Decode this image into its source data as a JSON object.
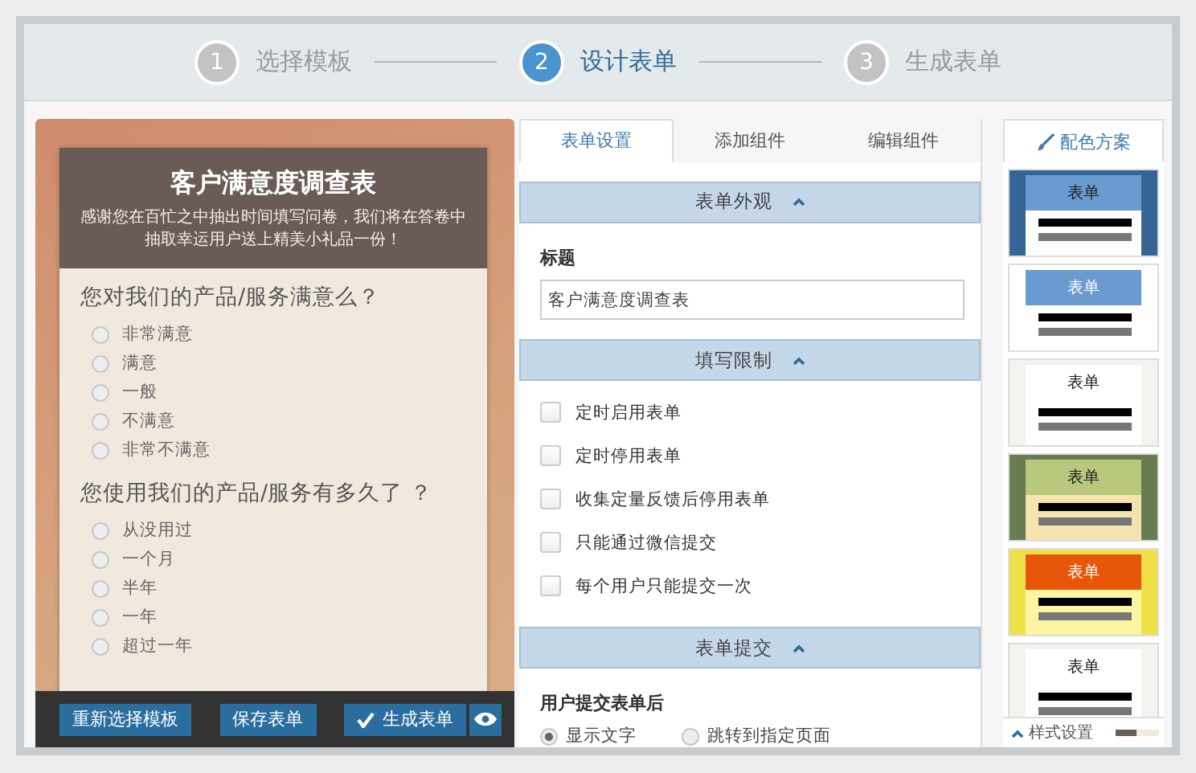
{
  "steps": [
    {
      "number": "1",
      "label": "选择模板",
      "selected": false
    },
    {
      "number": "2",
      "label": "设计表单",
      "selected": true
    },
    {
      "number": "3",
      "label": "生成表单",
      "selected": false
    }
  ],
  "preview": {
    "title": "客户满意度调查表",
    "subtitle": "感谢您在百忙之中抽出时间填写问卷，我们将在答卷中抽取幸运用户送上精美小礼品一份！",
    "questions": [
      {
        "text": "您对我们的产品/服务满意么？",
        "options": [
          {
            "label": "非常满意",
            "selected": false
          },
          {
            "label": "满意",
            "selected": false
          },
          {
            "label": "一般",
            "selected": false
          },
          {
            "label": "不满意",
            "selected": false
          },
          {
            "label": "非常不满意",
            "selected": false
          }
        ]
      },
      {
        "text": "您使用我们的产品/服务有多久了 ？",
        "options": [
          {
            "label": "从没用过",
            "selected": false
          },
          {
            "label": "一个月",
            "selected": false
          },
          {
            "label": "半年",
            "selected": false
          },
          {
            "label": "一年",
            "selected": false
          },
          {
            "label": "超过一年",
            "selected": false
          }
        ]
      }
    ],
    "buttons": [
      {
        "label": "重新选择模板",
        "kind": "plain"
      },
      {
        "label": "保存表单",
        "kind": "plain"
      },
      {
        "label": "生成表单",
        "kind": "check"
      },
      {
        "kind": "eye"
      }
    ]
  },
  "tabs": [
    {
      "label": "表单设置",
      "selected": true
    },
    {
      "label": "添加组件",
      "selected": false
    },
    {
      "label": "编辑组件",
      "selected": false
    }
  ],
  "sections": [
    {
      "title": "表单外观",
      "field_label": "标题",
      "field_value": "客户满意度调查表"
    },
    {
      "title": "填写限制",
      "checkboxes": [
        {
          "label": "定时启用表单",
          "checked": false
        },
        {
          "label": "定时停用表单",
          "checked": false
        },
        {
          "label": "收集定量反馈后停用表单",
          "checked": false
        },
        {
          "label": "只能通过微信提交",
          "checked": false
        },
        {
          "label": "每个用户只能提交一次",
          "checked": false
        }
      ]
    },
    {
      "title": "表单提交",
      "field_label": "用户提交表单后",
      "radios": [
        {
          "label": "显示文字",
          "selected": true
        },
        {
          "label": "跳转到指定页面",
          "selected": false
        }
      ]
    }
  ],
  "palette": {
    "tab": "配色方案",
    "themes": [
      {
        "label": "表单",
        "kind": "navy"
      },
      {
        "label": "表单",
        "kind": "sky"
      },
      {
        "label": "表单",
        "kind": "plain"
      },
      {
        "label": "表单",
        "kind": "olive"
      },
      {
        "label": "表单",
        "kind": "sunset"
      },
      {
        "label": "表单",
        "kind": "plain"
      }
    ],
    "footer": "样式设置"
  }
}
